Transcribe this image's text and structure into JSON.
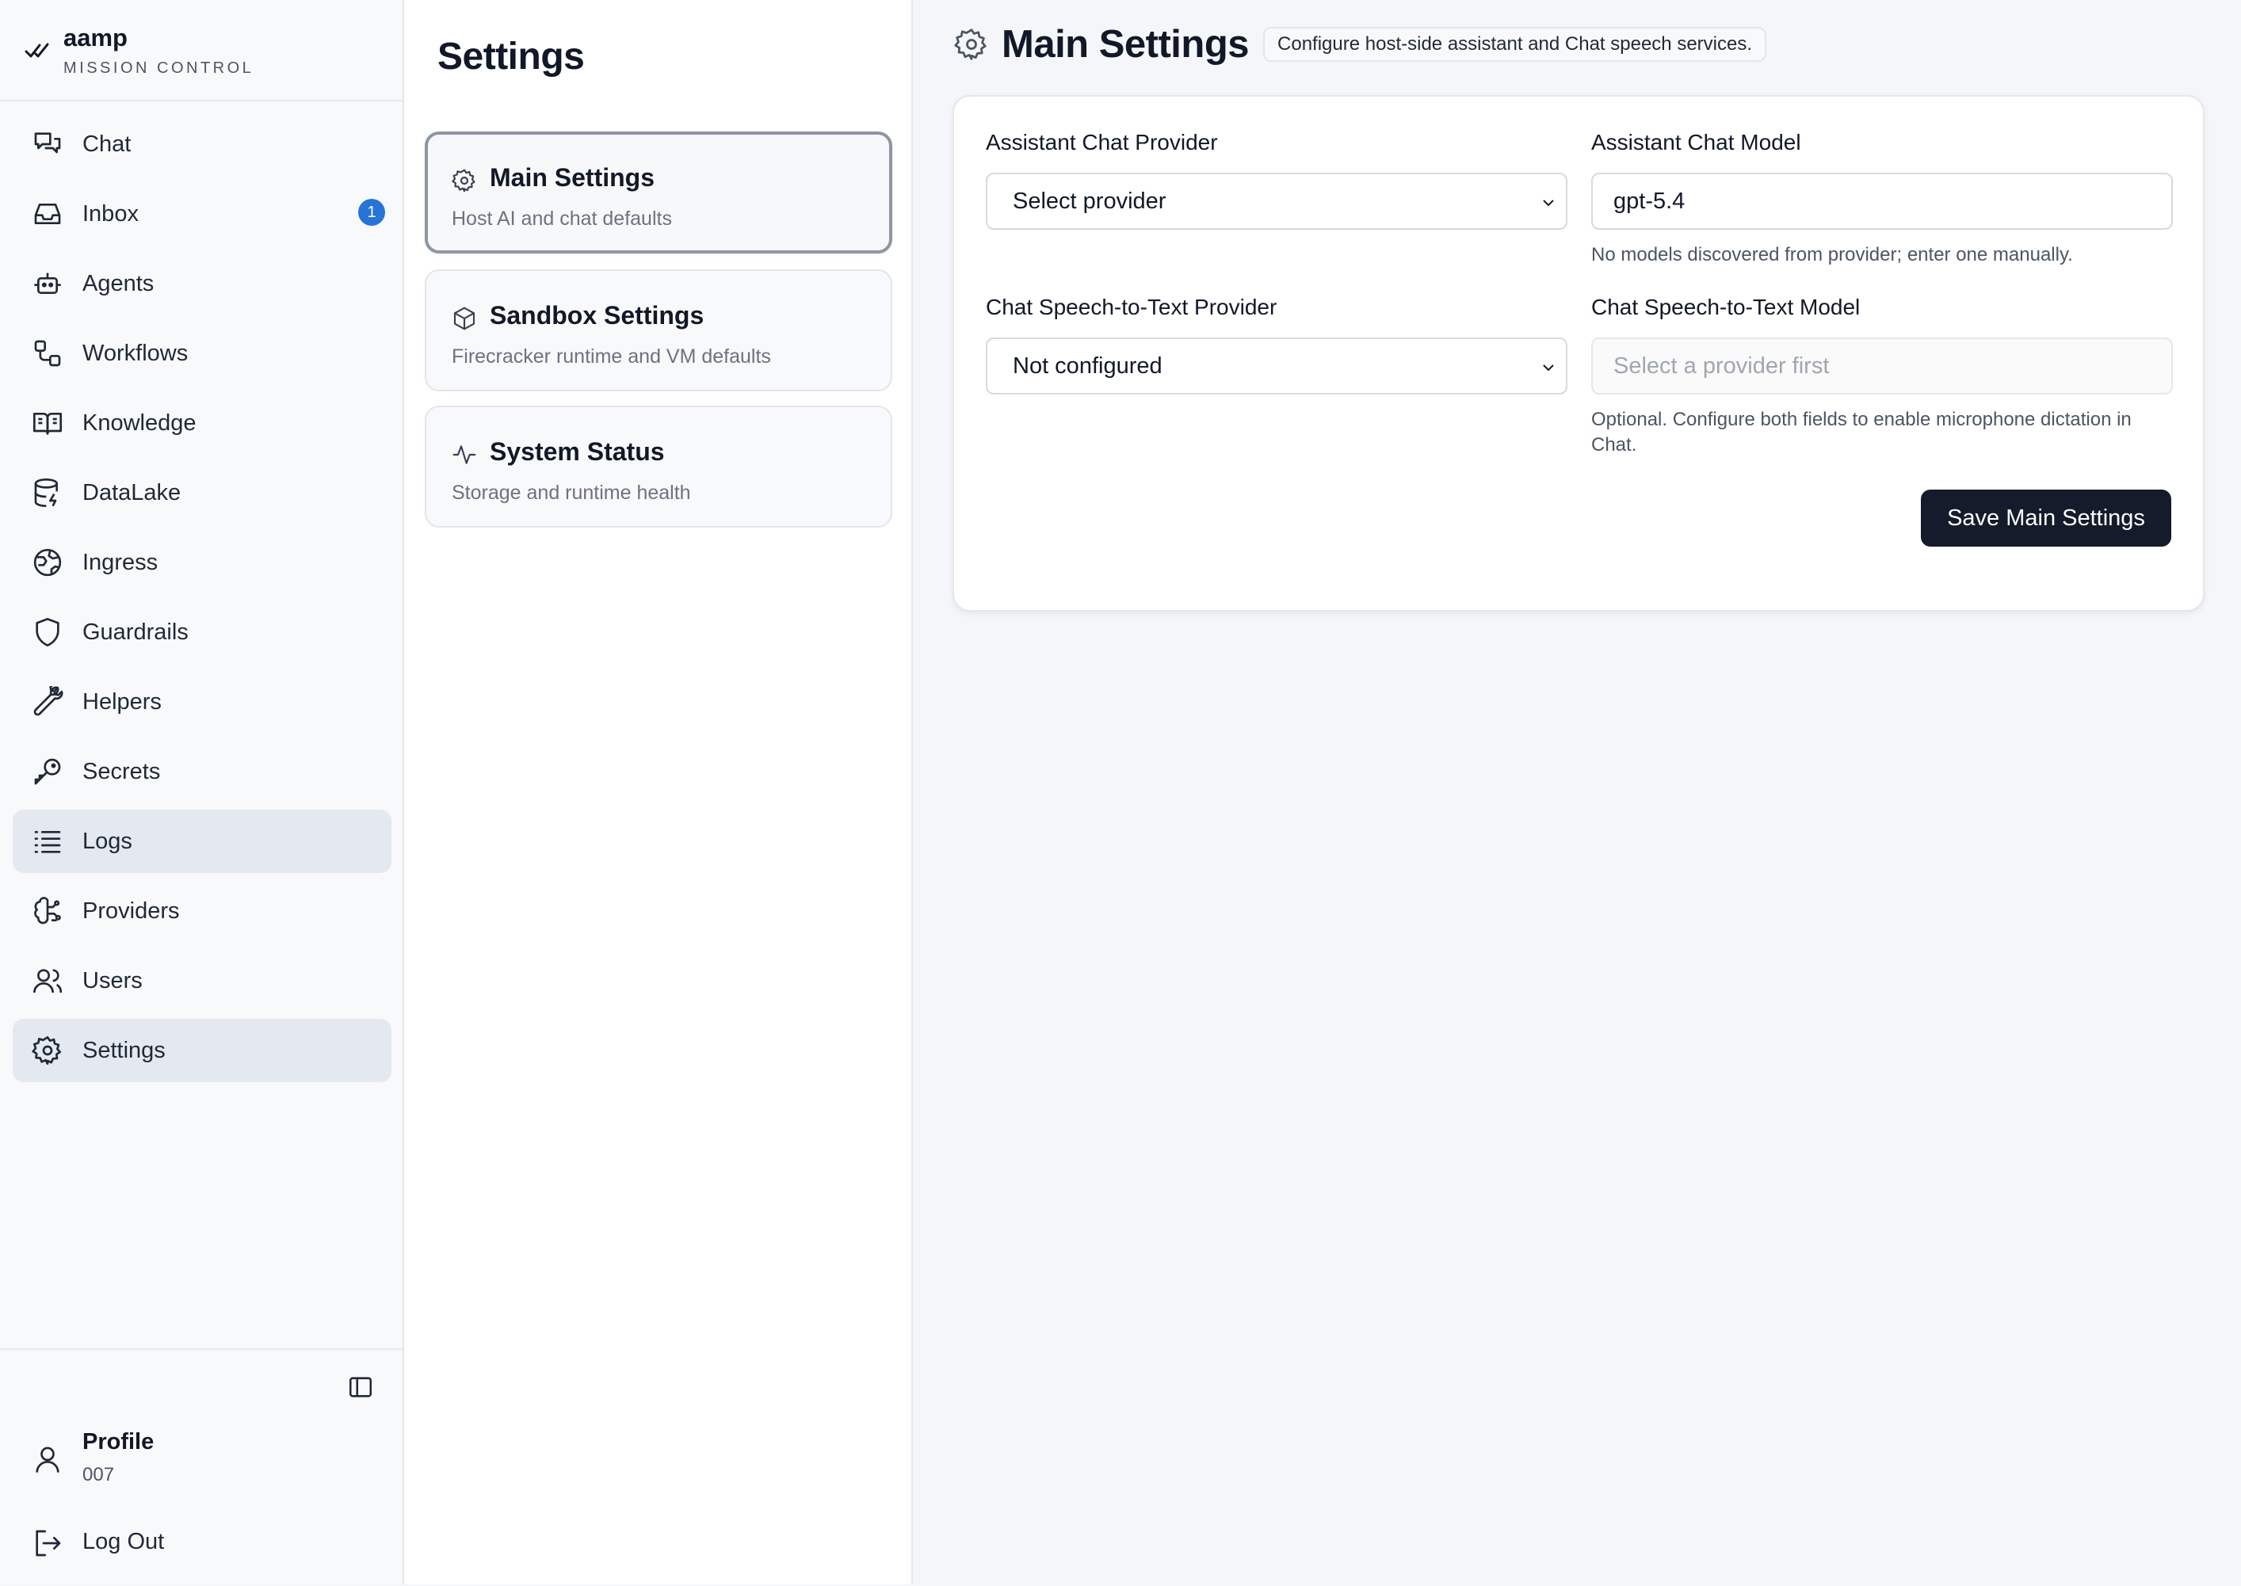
{
  "brand": {
    "name": "aamp",
    "subtitle": "MISSION CONTROL"
  },
  "sidebar": {
    "items": [
      {
        "label": "Chat",
        "icon": "chat-icon"
      },
      {
        "label": "Inbox",
        "icon": "inbox-icon",
        "badge": "1"
      },
      {
        "label": "Agents",
        "icon": "robot-icon"
      },
      {
        "label": "Workflows",
        "icon": "workflow-icon"
      },
      {
        "label": "Knowledge",
        "icon": "book-icon"
      },
      {
        "label": "DataLake",
        "icon": "database-icon"
      },
      {
        "label": "Ingress",
        "icon": "globe-icon"
      },
      {
        "label": "Guardrails",
        "icon": "shield-icon"
      },
      {
        "label": "Helpers",
        "icon": "wrench-icon"
      },
      {
        "label": "Secrets",
        "icon": "key-icon"
      },
      {
        "label": "Logs",
        "icon": "list-icon",
        "active": true
      },
      {
        "label": "Providers",
        "icon": "brain-icon"
      },
      {
        "label": "Users",
        "icon": "users-icon"
      },
      {
        "label": "Settings",
        "icon": "gear-icon",
        "active": true
      }
    ],
    "profile": {
      "label": "Profile",
      "id": "007"
    },
    "logout_label": "Log Out"
  },
  "settings_panel": {
    "title": "Settings",
    "cards": [
      {
        "title": "Main Settings",
        "subtitle": "Host AI and chat defaults",
        "icon": "gear-icon",
        "selected": true
      },
      {
        "title": "Sandbox Settings",
        "subtitle": "Firecracker runtime and VM defaults",
        "icon": "cube-icon"
      },
      {
        "title": "System Status",
        "subtitle": "Storage and runtime health",
        "icon": "activity-icon"
      }
    ]
  },
  "main": {
    "title": "Main Settings",
    "description": "Configure host-side assistant and Chat speech services.",
    "form": {
      "chat_provider": {
        "label": "Assistant Chat Provider",
        "value": "Select provider"
      },
      "chat_model": {
        "label": "Assistant Chat Model",
        "value": "gpt-5.4",
        "help": "No models discovered from provider; enter one manually."
      },
      "stt_provider": {
        "label": "Chat Speech-to-Text Provider",
        "value": "Not configured"
      },
      "stt_model": {
        "label": "Chat Speech-to-Text Model",
        "placeholder": "Select a provider first",
        "help": "Optional. Configure both fields to enable microphone dictation in Chat."
      },
      "save_label": "Save Main Settings"
    }
  },
  "colors": {
    "accent_dark": "#141b2b",
    "badge": "#2773d8",
    "active_nav": "#e4e8ef"
  }
}
